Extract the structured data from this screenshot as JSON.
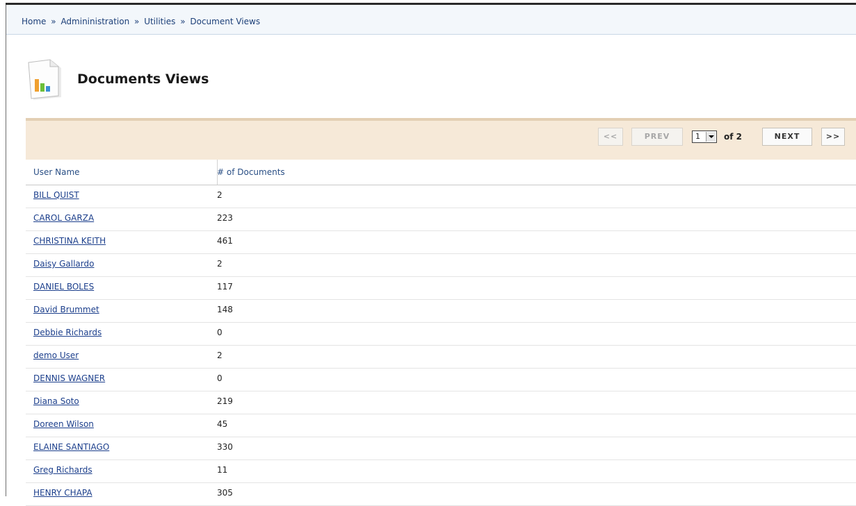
{
  "breadcrumb": {
    "home": "Home",
    "sep": "»",
    "admin": "Admininistration",
    "utilities": "Utilities",
    "current": "Document Views"
  },
  "page": {
    "title": "Documents Views",
    "icon": "report-chart-icon"
  },
  "pager": {
    "first": "<<",
    "prev": "PREV",
    "current_page": "1",
    "of_text": "of 2",
    "next": "NEXT",
    "last": ">>"
  },
  "table": {
    "headers": {
      "user_name": "User Name",
      "num_docs": "# of Documents"
    },
    "rows": [
      {
        "name": "BILL QUIST",
        "count": "2"
      },
      {
        "name": "CAROL GARZA",
        "count": "223"
      },
      {
        "name": "CHRISTINA KEITH",
        "count": "461"
      },
      {
        "name": "Daisy Gallardo",
        "count": "2"
      },
      {
        "name": "DANIEL BOLES",
        "count": "117"
      },
      {
        "name": "David Brummet",
        "count": "148"
      },
      {
        "name": "Debbie Richards",
        "count": "0"
      },
      {
        "name": "demo User",
        "count": "2"
      },
      {
        "name": "DENNIS WAGNER",
        "count": "0"
      },
      {
        "name": "Diana Soto",
        "count": "219"
      },
      {
        "name": "Doreen Wilson",
        "count": "45"
      },
      {
        "name": "ELAINE SANTIAGO",
        "count": "330"
      },
      {
        "name": "Greg Richards",
        "count": "11"
      },
      {
        "name": "HENRY CHAPA",
        "count": "305"
      }
    ]
  },
  "colors": {
    "panel": "#f6e9d8",
    "link": "#1c3f8c",
    "breadcrumb_bg": "#f3f7fb"
  }
}
